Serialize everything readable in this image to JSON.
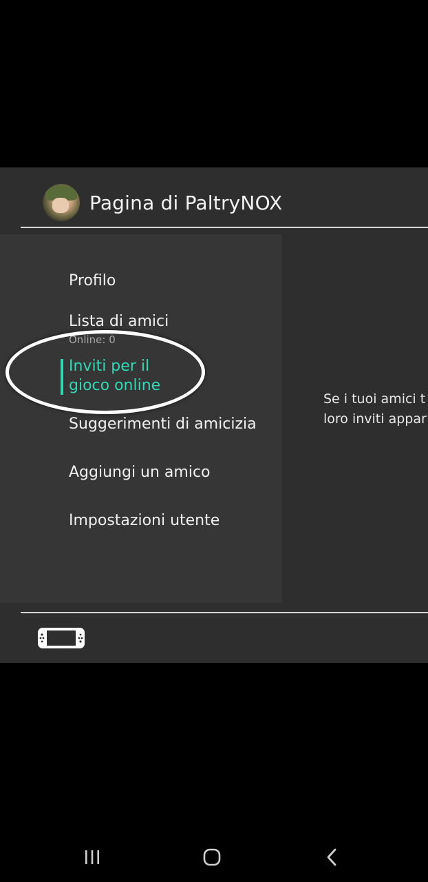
{
  "header": {
    "title": "Pagina di PaltryNOX"
  },
  "menu": {
    "profile": "Profilo",
    "friends_list": "Lista di amici",
    "friends_online": "Online: 0",
    "invites_line1": "Inviti per il",
    "invites_line2": "gioco online",
    "suggestions": "Suggerimenti di amicizia",
    "add_friend": "Aggiungi un amico",
    "user_settings": "Impostazioni utente"
  },
  "content": {
    "line1": "Se i tuoi amici t",
    "line2": "loro inviti appar"
  },
  "colors": {
    "accent": "#2fd9b4",
    "background": "#2e2e2e",
    "sidebar": "#363636",
    "annotation": "#ffffff"
  },
  "icons": {
    "avatar": "user-avatar",
    "console": "console-handheld-icon",
    "recents": "recent-apps-icon",
    "home": "home-icon",
    "back": "back-icon"
  }
}
